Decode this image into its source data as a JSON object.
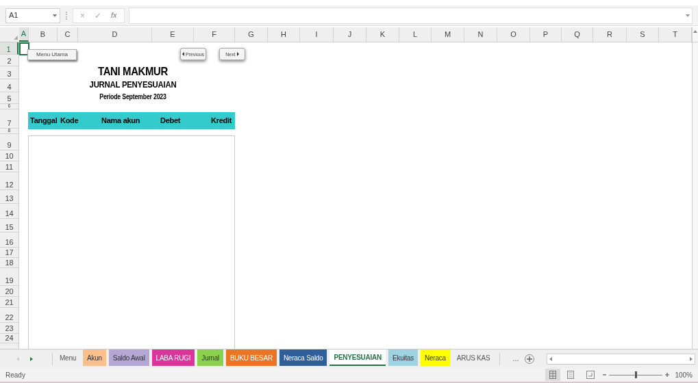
{
  "formula_bar": {
    "name_box": "A1",
    "cancel": "×",
    "enter": "✓",
    "function": "fx"
  },
  "columns": [
    {
      "label": "A",
      "selected": true
    },
    {
      "label": "B",
      "selected": false
    },
    {
      "label": "C",
      "selected": false
    },
    {
      "label": "D",
      "selected": false
    },
    {
      "label": "E",
      "selected": false
    },
    {
      "label": "F",
      "selected": false
    },
    {
      "label": "G",
      "selected": false
    },
    {
      "label": "H",
      "selected": false
    },
    {
      "label": "I",
      "selected": false
    },
    {
      "label": "J",
      "selected": false
    },
    {
      "label": "K",
      "selected": false
    },
    {
      "label": "L",
      "selected": false
    },
    {
      "label": "M",
      "selected": false
    },
    {
      "label": "N",
      "selected": false
    },
    {
      "label": "O",
      "selected": false
    },
    {
      "label": "P",
      "selected": false
    },
    {
      "label": "Q",
      "selected": false
    },
    {
      "label": "R",
      "selected": false
    },
    {
      "label": "S",
      "selected": false
    },
    {
      "label": "T",
      "selected": false
    }
  ],
  "rows": [
    {
      "label": "1",
      "selected": true
    },
    {
      "label": "2",
      "selected": false
    },
    {
      "label": "3",
      "selected": false
    },
    {
      "label": "4",
      "selected": false
    },
    {
      "label": "5",
      "selected": false
    },
    {
      "label": "6",
      "selected": false
    },
    {
      "label": "7",
      "selected": false
    },
    {
      "label": "8",
      "selected": false
    },
    {
      "label": "9",
      "selected": false
    },
    {
      "label": "10",
      "selected": false
    },
    {
      "label": "11",
      "selected": false
    },
    {
      "label": "12",
      "selected": false
    },
    {
      "label": "13",
      "selected": false
    },
    {
      "label": "14",
      "selected": false
    },
    {
      "label": "15",
      "selected": false
    },
    {
      "label": "16",
      "selected": false
    },
    {
      "label": "17",
      "selected": false
    },
    {
      "label": "18",
      "selected": false
    },
    {
      "label": "19",
      "selected": false
    },
    {
      "label": "20",
      "selected": false
    },
    {
      "label": "21",
      "selected": false
    },
    {
      "label": "22",
      "selected": false
    },
    {
      "label": "23",
      "selected": false
    },
    {
      "label": "24",
      "selected": false
    }
  ],
  "sheet": {
    "buttons": [
      {
        "kind": "menu",
        "label": "Menu Utama"
      },
      {
        "kind": "prev",
        "label": "Previous"
      },
      {
        "kind": "next",
        "label": "Next"
      }
    ],
    "titles": [
      "TANI MAKMUR",
      "JURNAL PENYESUAIAN",
      "Periode September 2023"
    ],
    "table_columns": [
      "Tanggal",
      "Kode",
      "Nama akun",
      "Debet",
      "Kredit"
    ]
  },
  "tabs": [
    {
      "label": "Menu",
      "selected": false
    },
    {
      "label": "Akun",
      "selected": false,
      "color": "#fbc08c"
    },
    {
      "label": "Saldo Awal",
      "selected": false,
      "color": "#b4a7d6"
    },
    {
      "label": "LABA RUGI",
      "selected": false,
      "color": "#d9359b"
    },
    {
      "label": "Jurnal",
      "selected": false,
      "color": "#8cd14b"
    },
    {
      "label": "BUKU BESAR",
      "selected": false,
      "color": "#ec7524"
    },
    {
      "label": "Neraca Saldo",
      "selected": false,
      "color": "#2f5e98"
    },
    {
      "label": "PENYESUAIAN",
      "selected": true
    },
    {
      "label": "Ekuitas",
      "selected": false,
      "color": "#9dd3e2"
    },
    {
      "label": "Neraca",
      "selected": false,
      "color": "#ffff00"
    },
    {
      "label": "ARUS KAS",
      "selected": false
    }
  ],
  "tab_overflow": "...",
  "status_bar": {
    "status": "Ready",
    "zoom": "100%",
    "zoom_slider": {
      "level": 0.5
    }
  }
}
